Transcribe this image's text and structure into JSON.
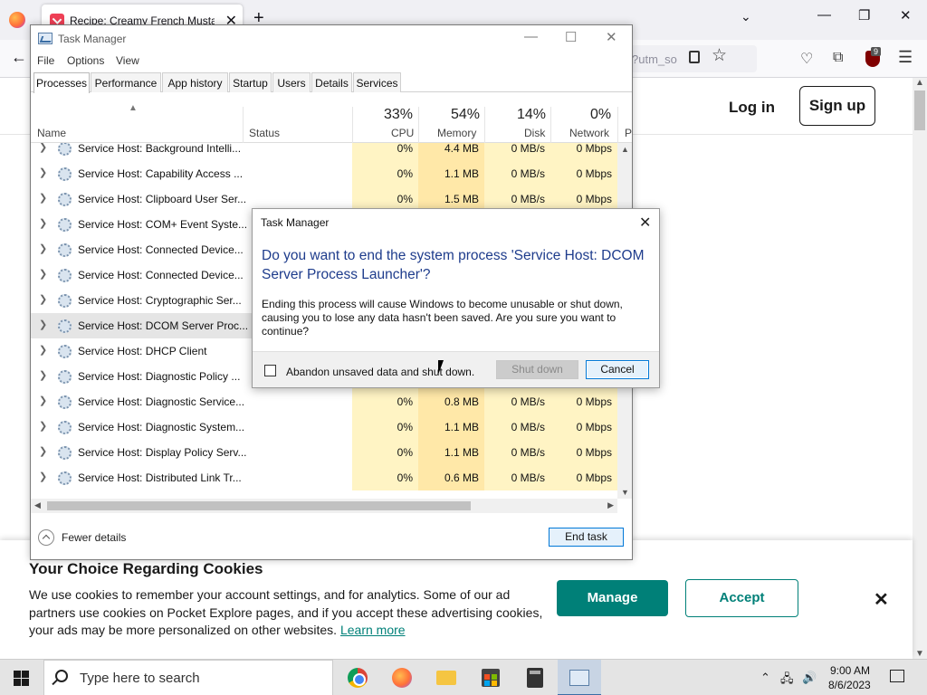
{
  "browser": {
    "tab_title": "Recipe: Creamy French Mustard",
    "url_fragment": "?utm_so",
    "extension_badge": "9",
    "colors": {
      "tab_icon": "#ef4056"
    }
  },
  "page": {
    "login": "Log in",
    "signup": "Sign up"
  },
  "cookie_banner": {
    "title": "Your Choice Regarding Cookies",
    "text": "We use cookies to remember your account settings, and for analytics. Some of our ad partners use cookies on Pocket Explore pages, and if you accept these advertising cookies, your ads may be more personalized on other websites.",
    "learn_more": "Learn more",
    "manage": "Manage",
    "accept": "Accept",
    "colors": {
      "accent": "#008078"
    }
  },
  "task_manager": {
    "title": "Task Manager",
    "menu": [
      "File",
      "Options",
      "View"
    ],
    "tabs": [
      "Processes",
      "Performance",
      "App history",
      "Startup",
      "Users",
      "Details",
      "Services"
    ],
    "active_tab": "Processes",
    "columns": {
      "name": "Name",
      "status": "Status",
      "cpu": {
        "pct": "33%",
        "label": "CPU"
      },
      "memory": {
        "pct": "54%",
        "label": "Memory"
      },
      "disk": {
        "pct": "14%",
        "label": "Disk"
      },
      "network": {
        "pct": "0%",
        "label": "Network"
      },
      "power_partial": "P"
    },
    "rows": [
      {
        "name": "Service Host: Background Intelli...",
        "cpu": "0%",
        "mem": "4.4 MB",
        "disk": "0 MB/s",
        "net": "0 Mbps"
      },
      {
        "name": "Service Host: Capability Access ...",
        "cpu": "0%",
        "mem": "1.1 MB",
        "disk": "0 MB/s",
        "net": "0 Mbps"
      },
      {
        "name": "Service Host: Clipboard User Ser...",
        "cpu": "0%",
        "mem": "1.5 MB",
        "disk": "0 MB/s",
        "net": "0 Mbps"
      },
      {
        "name": "Service Host: COM+ Event Syste...",
        "cpu": "",
        "mem": "",
        "disk": "",
        "net": ""
      },
      {
        "name": "Service Host: Connected Device...",
        "cpu": "",
        "mem": "",
        "disk": "",
        "net": ""
      },
      {
        "name": "Service Host: Connected Device...",
        "cpu": "",
        "mem": "",
        "disk": "",
        "net": ""
      },
      {
        "name": "Service Host: Cryptographic Ser...",
        "cpu": "",
        "mem": "",
        "disk": "",
        "net": ""
      },
      {
        "name": "Service Host: DCOM Server Proc...",
        "cpu": "",
        "mem": "",
        "disk": "",
        "net": ""
      },
      {
        "name": "Service Host: DHCP Client",
        "cpu": "",
        "mem": "",
        "disk": "",
        "net": ""
      },
      {
        "name": "Service Host: Diagnostic Policy ...",
        "cpu": "",
        "mem": "",
        "disk": "",
        "net": ""
      },
      {
        "name": "Service Host: Diagnostic Service...",
        "cpu": "0%",
        "mem": "0.8 MB",
        "disk": "0 MB/s",
        "net": "0 Mbps"
      },
      {
        "name": "Service Host: Diagnostic System...",
        "cpu": "0%",
        "mem": "1.1 MB",
        "disk": "0 MB/s",
        "net": "0 Mbps"
      },
      {
        "name": "Service Host: Display Policy Serv...",
        "cpu": "0%",
        "mem": "1.1 MB",
        "disk": "0 MB/s",
        "net": "0 Mbps"
      },
      {
        "name": "Service Host: Distributed Link Tr...",
        "cpu": "0%",
        "mem": "0.6 MB",
        "disk": "0 MB/s",
        "net": "0 Mbps"
      }
    ],
    "selected_row": 7,
    "fewer_details": "Fewer details",
    "end_task": "End task"
  },
  "dialog": {
    "title": "Task Manager",
    "question": "Do you want to end the system process 'Service Host: DCOM Server Process Launcher'?",
    "body": "Ending this process will cause Windows to become unusable or shut down, causing you to lose any data hasn't been saved. Are you sure you want to continue?",
    "checkbox_label": "Abandon unsaved data and shut down.",
    "checkbox_checked": false,
    "shutdown": "Shut down",
    "cancel": "Cancel"
  },
  "taskbar": {
    "search_placeholder": "Type here to search",
    "apps": [
      "chrome-icon",
      "firefox-icon",
      "file-explorer-icon",
      "store-icon",
      "calculator-icon",
      "task-manager-icon"
    ],
    "time": "9:00 AM",
    "date": "8/6/2023"
  }
}
